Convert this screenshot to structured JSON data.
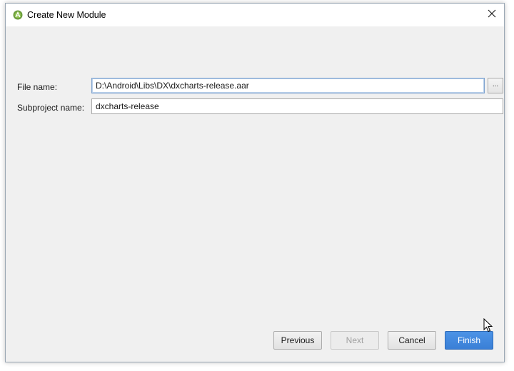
{
  "window": {
    "title": "Create New Module",
    "icon": "android-studio-icon",
    "close_icon": "close-icon"
  },
  "form": {
    "file_name": {
      "label": "File name:",
      "value": "D:\\Android\\Libs\\DX\\dxcharts-release.aar",
      "browse_label": "..."
    },
    "subproject_name": {
      "label": "Subproject name:",
      "value": "dxcharts-release"
    }
  },
  "buttons": {
    "previous": "Previous",
    "next": "Next",
    "cancel": "Cancel",
    "finish": "Finish"
  },
  "colors": {
    "primary_button": "#3a7fd6",
    "dialog_background": "#f0f0f0",
    "focus_border": "#7da2ce"
  }
}
